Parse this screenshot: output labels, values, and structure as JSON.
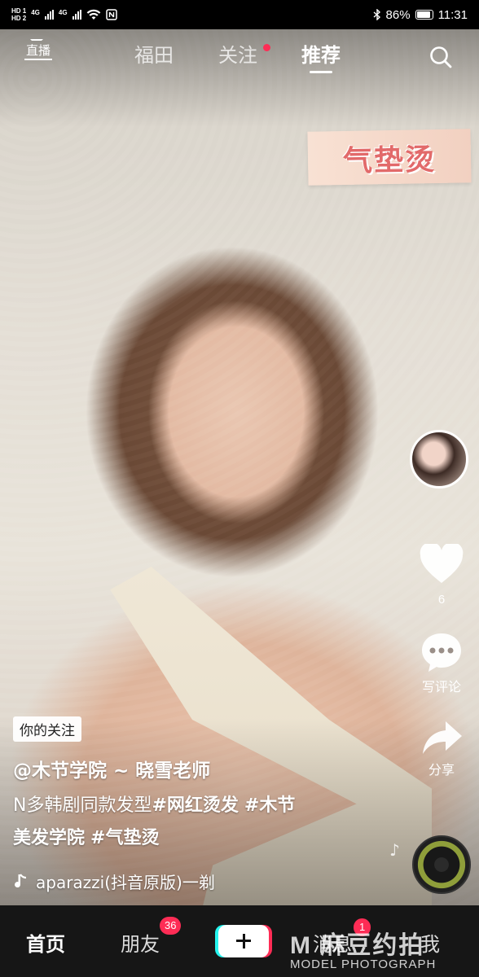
{
  "status_bar": {
    "sim_labels": [
      "HD 1",
      "HD 2"
    ],
    "network": "4G",
    "battery": "86%",
    "time": "11:31"
  },
  "top_nav": {
    "live_label": "直播",
    "tabs": [
      {
        "label": "福田",
        "active": false
      },
      {
        "label": "关注",
        "active": false,
        "has_dot": true
      },
      {
        "label": "推荐",
        "active": true
      }
    ]
  },
  "video": {
    "sticker_text": "气垫烫",
    "follow_tag": "你的关注",
    "author": "@木节学院 ~ 晓雪老师",
    "description_plain": "N多韩剧同款发型",
    "hashtags": [
      "#网红烫发",
      "#木节",
      "美发学院",
      "#气垫烫"
    ],
    "music": "aparazzi(抖音原版)一剃"
  },
  "side_actions": {
    "like_count": "6",
    "comment_label": "写评论",
    "share_label": "分享"
  },
  "bottom_bar": {
    "home": "首页",
    "friends": "朋友",
    "friends_badge": "36",
    "messages": "消息",
    "messages_badge": "1",
    "me": "我"
  },
  "watermark": {
    "line1": "M 麻豆约拍",
    "line2": "MODEL PHOTOGRAPH"
  },
  "colors": {
    "accent": "#fe2c55",
    "cyan": "#25f4ee",
    "bottom_bar_bg": "#161616"
  }
}
